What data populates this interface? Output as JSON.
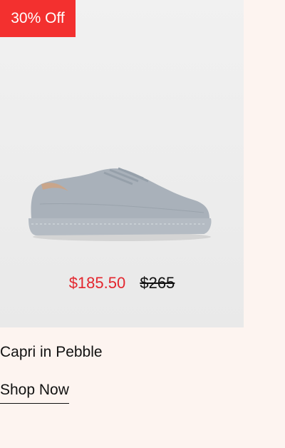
{
  "product": {
    "badge": "30% Off",
    "sale_price": "$185.50",
    "original_price": "$265",
    "title": "Capri in Pebble",
    "cta_label": "Shop Now"
  },
  "colors": {
    "badge_bg": "#f3302f",
    "sale_price": "#e3262e",
    "page_bg": "#fdf4f0",
    "shoe": "#a9b1ba"
  },
  "icons": [
    "sneaker-image"
  ]
}
